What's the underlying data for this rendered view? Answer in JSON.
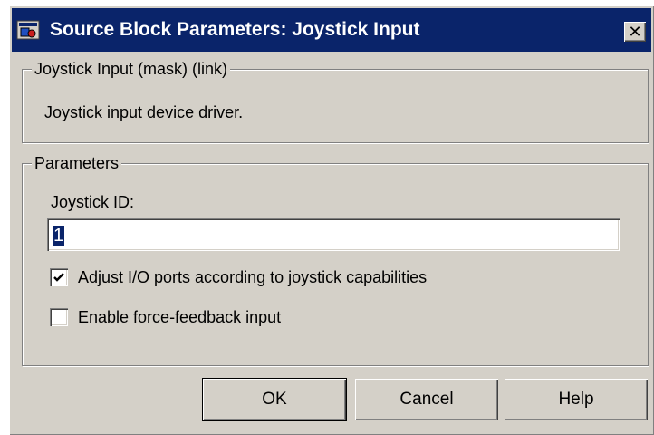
{
  "window": {
    "title": "Source Block Parameters: Joystick Input",
    "close_icon": "close-icon",
    "colors": {
      "titlebar": "#0a246a",
      "face": "#d4d0c8"
    }
  },
  "mask_group": {
    "label": "Joystick Input (mask) (link)",
    "description": "Joystick input device driver."
  },
  "params_group": {
    "label": "Parameters",
    "joystick_id_label": "Joystick ID:",
    "joystick_id_value": "1",
    "checkboxes": [
      {
        "label": "Adjust I/O ports according to joystick capabilities",
        "checked": true
      },
      {
        "label": "Enable force-feedback input",
        "checked": false
      }
    ]
  },
  "buttons": {
    "ok": "OK",
    "cancel": "Cancel",
    "help": "Help"
  }
}
